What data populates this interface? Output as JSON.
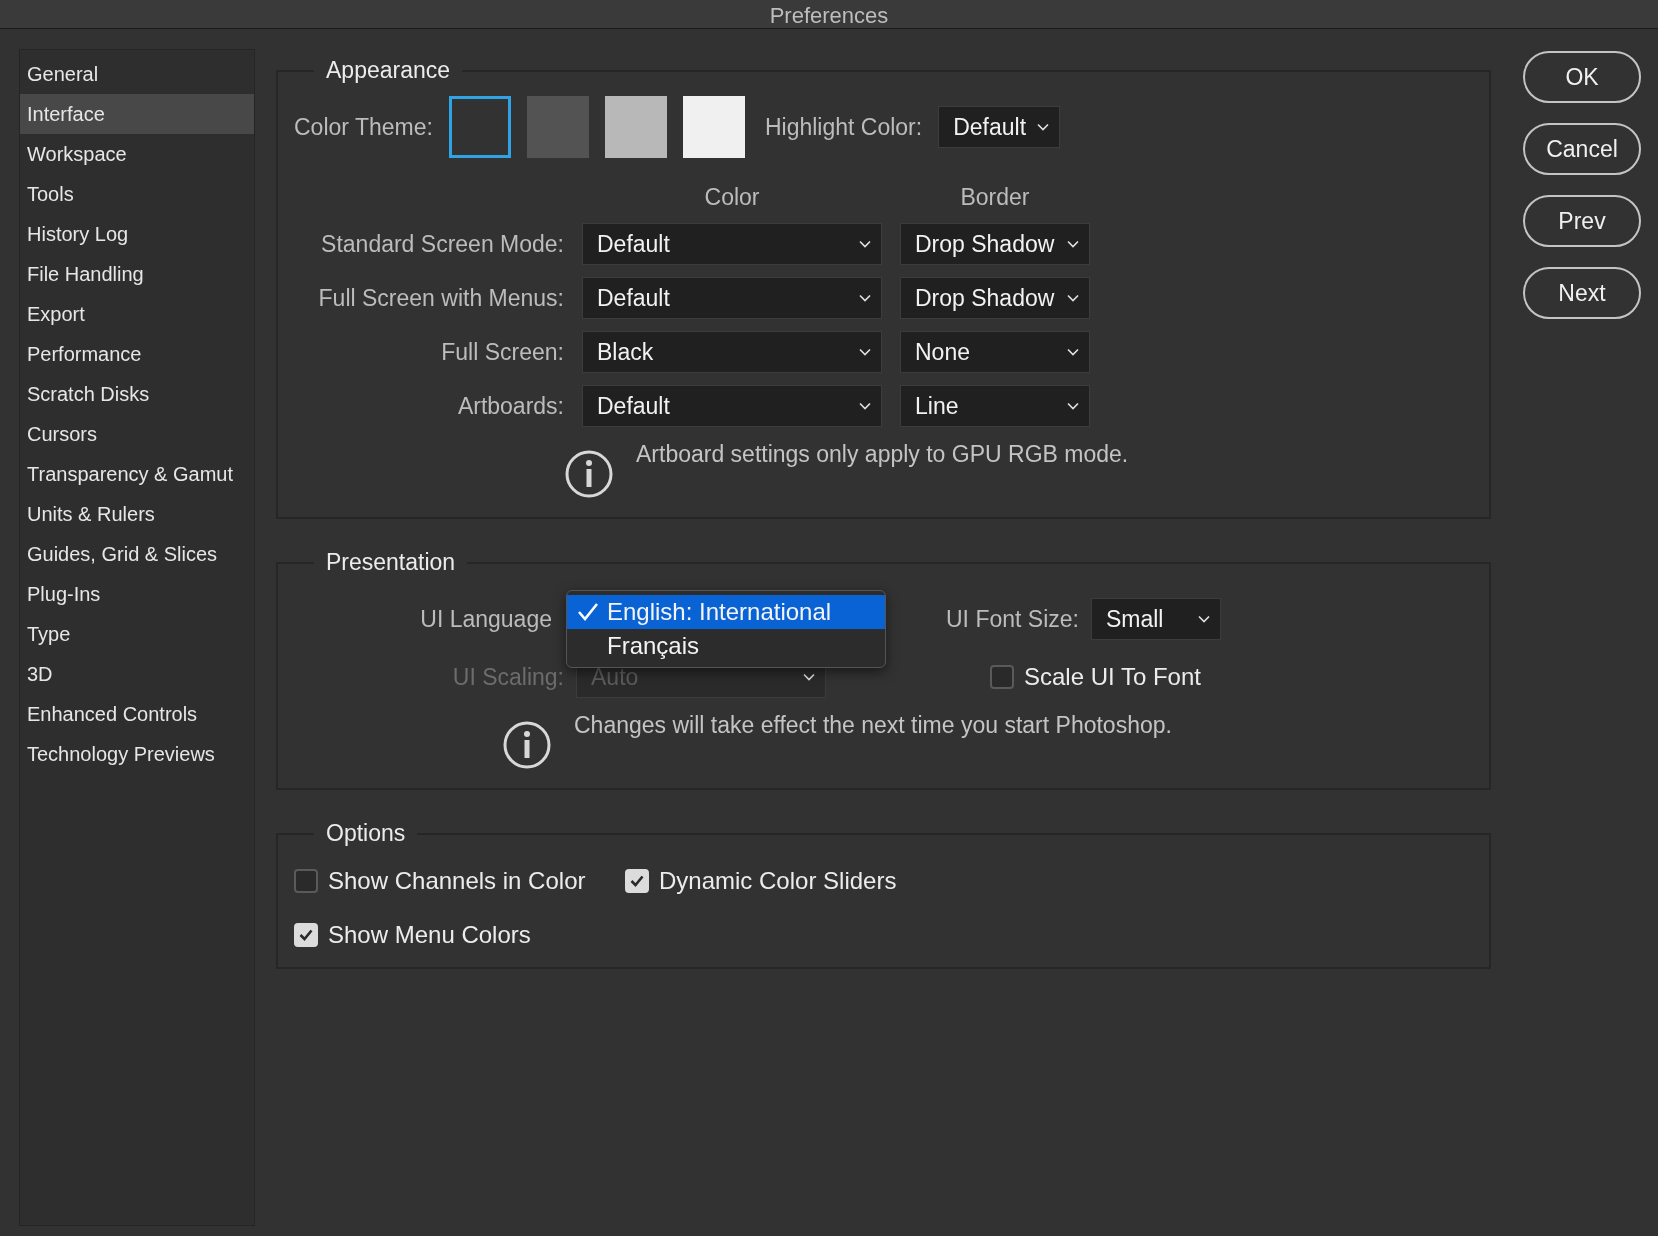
{
  "window": {
    "title": "Preferences"
  },
  "sidebar": {
    "items": [
      {
        "label": "General",
        "selected": false
      },
      {
        "label": "Interface",
        "selected": true
      },
      {
        "label": "Workspace",
        "selected": false
      },
      {
        "label": "Tools",
        "selected": false
      },
      {
        "label": "History Log",
        "selected": false
      },
      {
        "label": "File Handling",
        "selected": false
      },
      {
        "label": "Export",
        "selected": false
      },
      {
        "label": "Performance",
        "selected": false
      },
      {
        "label": "Scratch Disks",
        "selected": false
      },
      {
        "label": "Cursors",
        "selected": false
      },
      {
        "label": "Transparency & Gamut",
        "selected": false
      },
      {
        "label": "Units & Rulers",
        "selected": false
      },
      {
        "label": "Guides, Grid & Slices",
        "selected": false
      },
      {
        "label": "Plug-Ins",
        "selected": false
      },
      {
        "label": "Type",
        "selected": false
      },
      {
        "label": "3D",
        "selected": false
      },
      {
        "label": "Enhanced Controls",
        "selected": false
      },
      {
        "label": "Technology Previews",
        "selected": false
      }
    ]
  },
  "appearance": {
    "title": "Appearance",
    "color_theme": {
      "label": "Color Theme:",
      "swatches": [
        {
          "color": "#323232",
          "selected": true
        },
        {
          "color": "#535353",
          "selected": false
        },
        {
          "color": "#b8b8b8",
          "selected": false
        },
        {
          "color": "#f0f0f0",
          "selected": false
        }
      ]
    },
    "highlight_color": {
      "label": "Highlight Color:",
      "value": "Default"
    },
    "column_headers": [
      "Color",
      "Border"
    ],
    "rows": [
      {
        "label": "Standard Screen Mode:",
        "color_value": "Default",
        "border_value": "Drop Shadow"
      },
      {
        "label": "Full Screen with Menus:",
        "color_value": "Default",
        "border_value": "Drop Shadow"
      },
      {
        "label": "Full Screen:",
        "color_value": "Black",
        "border_value": "None"
      },
      {
        "label": "Artboards:",
        "color_value": "Default",
        "border_value": "Line"
      }
    ],
    "note": "Artboard settings only apply to GPU RGB mode."
  },
  "presentation": {
    "title": "Presentation",
    "ui_language": {
      "label": "UI Language",
      "menu": [
        {
          "label": "English: International",
          "selected": true
        },
        {
          "label": "Français",
          "selected": false
        }
      ]
    },
    "ui_scaling": {
      "label": "UI Scaling:",
      "value": "Auto",
      "disabled": true
    },
    "ui_font_size": {
      "label": "UI Font Size:",
      "value": "Small"
    },
    "scale_ui_to_font": {
      "label": "Scale UI To Font",
      "checked": false
    },
    "note": "Changes will take effect the next time you start Photoshop."
  },
  "options": {
    "title": "Options",
    "checkboxes": [
      {
        "label": "Show Channels in Color",
        "checked": false
      },
      {
        "label": "Dynamic Color Sliders",
        "checked": true
      },
      {
        "label": "Show Menu Colors",
        "checked": true
      }
    ]
  },
  "buttons": [
    "OK",
    "Cancel",
    "Prev",
    "Next"
  ]
}
